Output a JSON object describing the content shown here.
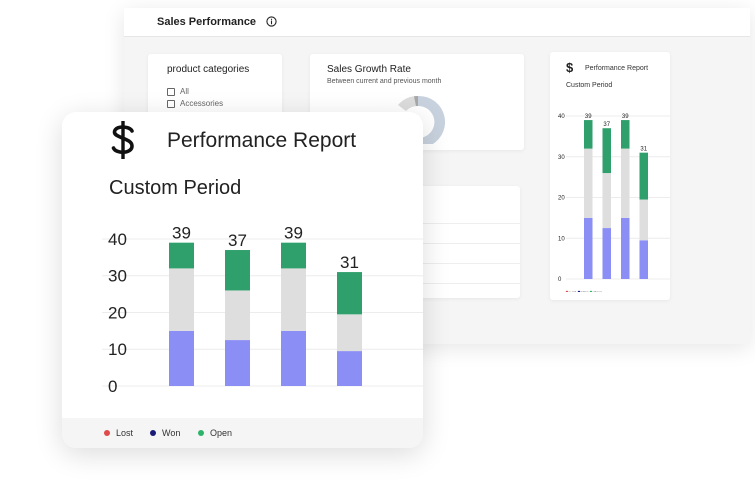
{
  "dashboard": {
    "title": "Sales Performance",
    "categories_card": {
      "title": "product categories",
      "items": [
        "All",
        "Accessories"
      ]
    },
    "growth_card": {
      "title": "Sales Growth Rate",
      "subtitle": "Between current and previous month"
    },
    "mini_report": {
      "title": "Performance Report",
      "subtitle": "Custom Period"
    }
  },
  "report": {
    "title": "Performance Report",
    "subtitle": "Custom Period",
    "legend": [
      "Lost",
      "Won",
      "Open"
    ],
    "colors": {
      "lost": "#e04a4a",
      "won": "#1a1a7a",
      "open": "#2eb36b",
      "bar_green": "#2f9f6c",
      "bar_gray": "#dedede",
      "bar_blue": "#8a8ef5"
    }
  },
  "chart_data": {
    "type": "bar",
    "stacked": true,
    "categories": [
      "",
      "",
      "",
      ""
    ],
    "totals": [
      39,
      37,
      39,
      31
    ],
    "series": [
      {
        "name": "",
        "values": [
          15,
          12.5,
          15,
          9.5
        ]
      },
      {
        "name": "",
        "values": [
          17,
          13.5,
          17,
          10
        ]
      },
      {
        "name": "",
        "values": [
          7,
          11,
          7,
          11.5
        ]
      }
    ],
    "yticks": [
      0,
      10,
      20,
      30,
      40
    ],
    "ylim": [
      0,
      40
    ],
    "grid": true
  }
}
